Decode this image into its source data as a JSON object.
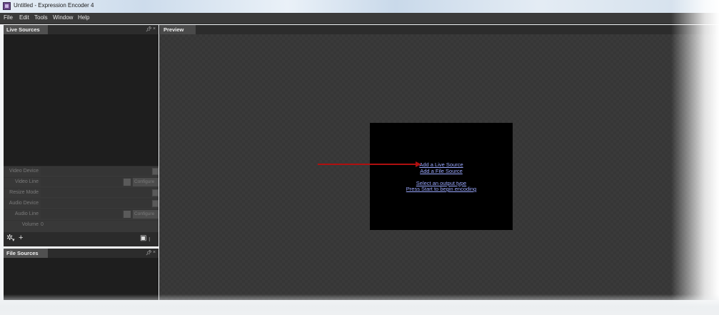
{
  "window": {
    "title": "Untitled - Expression Encoder 4"
  },
  "menu": {
    "items": [
      "File",
      "Edit",
      "Tools",
      "Window",
      "Help"
    ]
  },
  "live_sources": {
    "tab_label": "Live Sources",
    "properties": {
      "video_device": "Video Device",
      "video_line": "Video Line",
      "resize_mode": "Resize Mode",
      "audio_device": "Audio Device",
      "audio_line": "Audio Line",
      "volume": "Volume",
      "volume_value": "0",
      "configure_label": "Configure"
    }
  },
  "file_sources": {
    "tab_label": "File Sources"
  },
  "preview": {
    "tab_label": "Preview",
    "links": {
      "add_live": "Add a Live Source",
      "add_file": "Add a File Source",
      "select_output": "Select an output type",
      "press_start": "Press Start to begin encoding"
    }
  },
  "icons": {
    "pin": "pin-icon",
    "close": "close-icon",
    "settings": "gear-icon",
    "add": "plus-icon",
    "layout": "layout-grid-icon"
  },
  "colors": {
    "link": "#9aa8ff",
    "annotation_arrow": "#b01010",
    "panel_bg": "#1e1e1e",
    "preview_bg": "#3a3a3a"
  }
}
